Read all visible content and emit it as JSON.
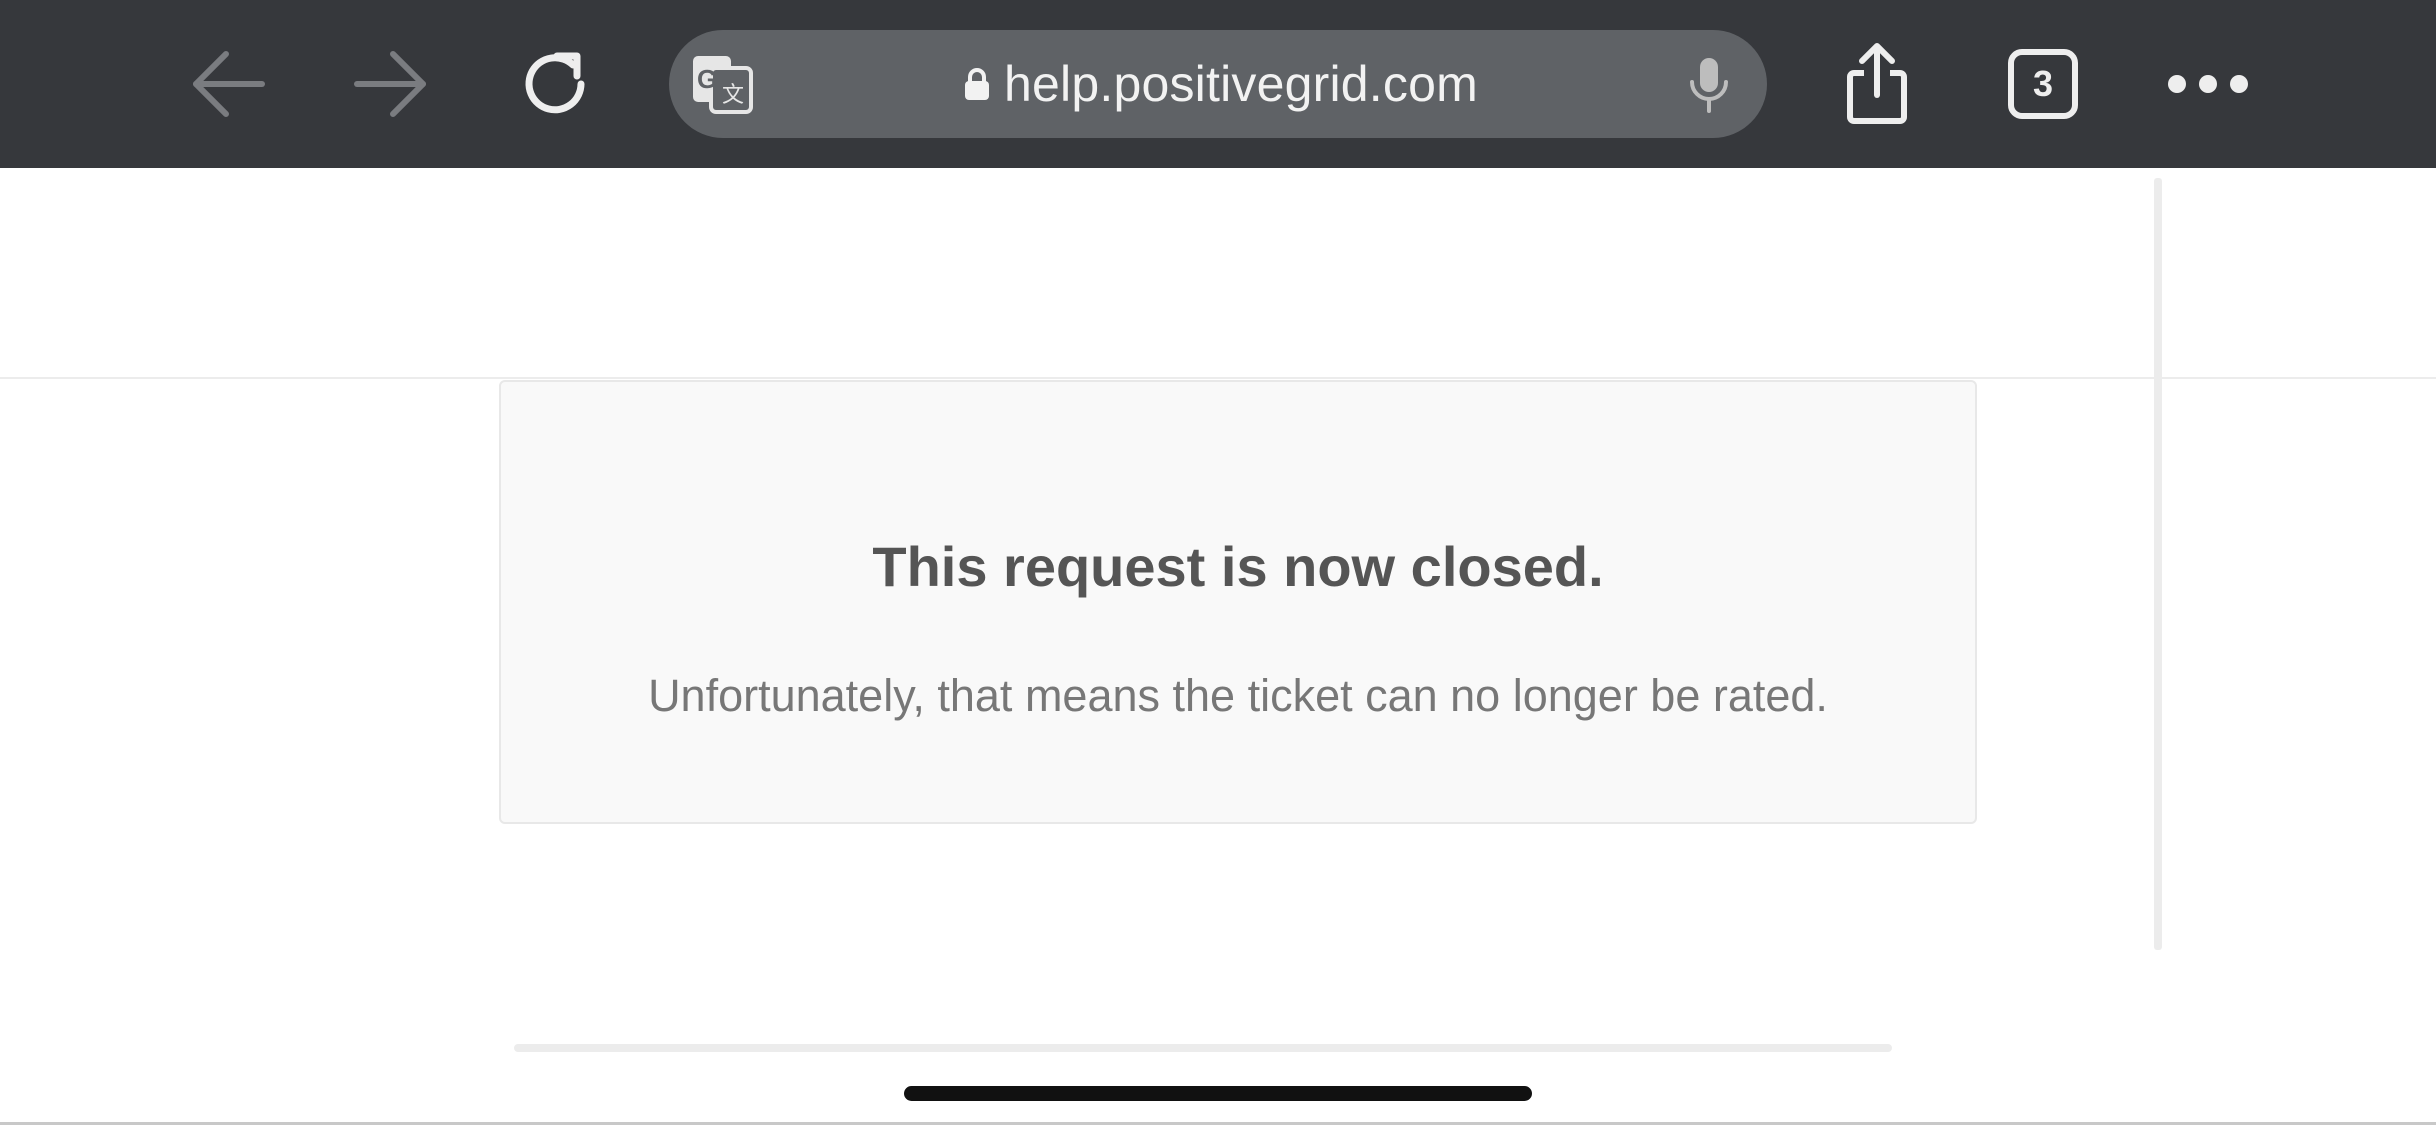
{
  "browser": {
    "url": "help.positivegrid.com",
    "tab_count": "3",
    "icons": {
      "back": "arrow-left-icon",
      "forward": "arrow-right-icon",
      "reload": "reload-icon",
      "translate": "translate-icon",
      "lock": "lock-icon",
      "microphone": "microphone-icon",
      "share": "share-icon",
      "more": "more-icon"
    },
    "colors": {
      "toolbar_bg": "#36383c",
      "address_bar_bg": "#5f6266",
      "disabled_icon": "#7a7c80",
      "active_icon": "#eeeeee"
    }
  },
  "page": {
    "title": "This request is now closed.",
    "message": "Unfortunately, that means the ticket can no longer be rated."
  }
}
